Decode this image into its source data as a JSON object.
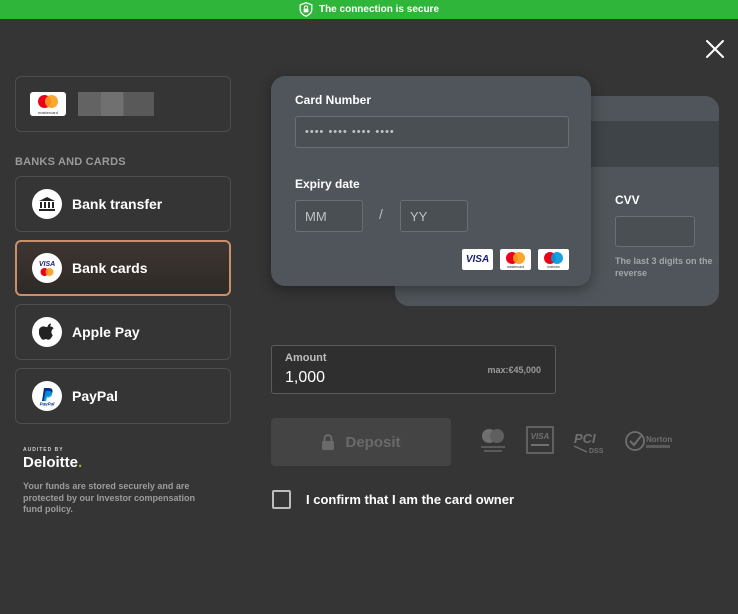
{
  "banner": {
    "text": "The connection is secure",
    "color": "#2fb53a"
  },
  "saved_card": {
    "logo_text": "mastercard"
  },
  "section_label": "BANKS AND CARDS",
  "methods": [
    {
      "label": "Bank transfer",
      "icon": "bank-icon"
    },
    {
      "label": "Bank cards",
      "icon": "visa-mastercard-icon",
      "active": true
    },
    {
      "label": "Apple Pay",
      "icon": "apple-icon"
    },
    {
      "label": "PayPal",
      "icon": "paypal-icon"
    }
  ],
  "audit": {
    "by": "AUDITED BY",
    "brand": "Deloitte",
    "brand_dot": ".",
    "note": "Your funds are stored securely and are protected by our Investor compensation fund policy."
  },
  "card_form": {
    "card_number_label": "Card Number",
    "card_number_placeholder": "•••• •••• •••• ••••",
    "expiry_label": "Expiry date",
    "month_placeholder": "MM",
    "slash": "/",
    "year_placeholder": "YY",
    "cvv_label": "CVV",
    "cvv_hint": "The last 3 digits on the reverse",
    "brand_logos": [
      "VISA",
      "mastercard",
      "maestro"
    ]
  },
  "amount": {
    "label": "Amount",
    "value": "1,000",
    "max": "max:€45,000"
  },
  "deposit": {
    "label": "Deposit"
  },
  "security_logos": [
    "MasterCard SecureCode",
    "Verified by VISA",
    "PCI DSS",
    "Norton SECURED"
  ],
  "confirm": {
    "label": "I confirm that I am the card owner",
    "checked": false
  },
  "colors": {
    "accent_border": "#c8906a",
    "background": "#353535",
    "card_bg": "#4f555a"
  }
}
